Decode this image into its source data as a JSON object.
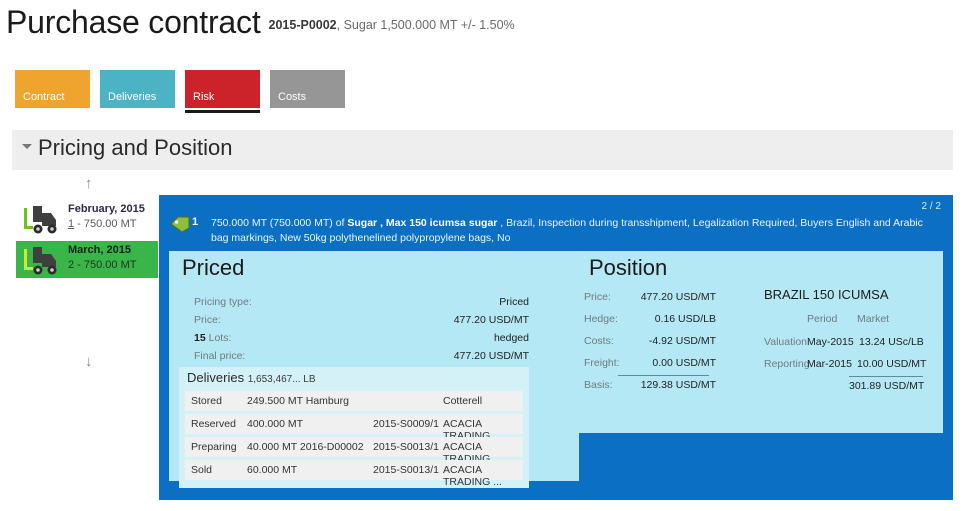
{
  "header": {
    "title": "Purchase contract",
    "ref": "2015-P0002",
    "subtitle": ", Sugar 1,500.000 MT +/- 1.50%"
  },
  "tabs": [
    {
      "label": "Contract",
      "color": "#F0A430",
      "selected": false
    },
    {
      "label": "Deliveries",
      "color": "#4BB3C4",
      "selected": false
    },
    {
      "label": "Risk",
      "color": "#CC2229",
      "selected": true
    },
    {
      "label": "Costs",
      "color": "#969696",
      "selected": false
    }
  ],
  "section": {
    "title": "Pricing and Position",
    "collapsed": false
  },
  "rail": {
    "scroll_up": "↑",
    "scroll_down": "↓",
    "items": [
      {
        "title": "February, 2015",
        "sub_num": "1",
        "sub_rest": " - 750.00 MT",
        "selected": false
      },
      {
        "title": "March, 2015",
        "sub_num": "2",
        "sub_rest": " - 750.00 MT",
        "selected": true
      }
    ]
  },
  "card": {
    "pager": "2 / 2",
    "item_number": "1",
    "desc_pre": "750.000 MT (750.000 MT) of ",
    "desc_bold1": "Sugar , Max 150 icumsa sugar",
    "desc_post": " , Brazil, Inspection during transshipment, Legalization Required, Buyers English and Arabic bag markings, New 50kg polythenelined polypropylene bags, No"
  },
  "priced": {
    "title": "Priced",
    "rows": [
      {
        "key": "Pricing type:",
        "value": "Priced"
      },
      {
        "key": "Price:",
        "value": "477.20 USD/MT"
      },
      {
        "key_bold": "15",
        "key": " Lots:",
        "value": "hedged"
      },
      {
        "key": "Final price:",
        "value": "477.20 USD/MT"
      }
    ],
    "deliveries": {
      "title": "Deliveries",
      "total": "1,653,467... LB",
      "rows": [
        {
          "status": "Stored",
          "qty": "249.500 MT Hamburg",
          "ref": "",
          "party": "Cotterell"
        },
        {
          "status": "Reserved",
          "qty": "400.000 MT",
          "ref": "2015-S0009/1",
          "party": "ACACIA TRADING ..."
        },
        {
          "status": "Preparing",
          "qty": "40.000 MT 2016-D00002",
          "ref": "2015-S0013/1",
          "party": "ACACIA TRADING ..."
        },
        {
          "status": "Sold",
          "qty": "60.000 MT",
          "ref": "2015-S0013/1",
          "party": "ACACIA TRADING ..."
        }
      ]
    }
  },
  "position": {
    "title": "Position",
    "rows": [
      {
        "key": "Price:",
        "value": "477.20 USD/MT"
      },
      {
        "key": "Hedge:",
        "value": "0.16 USD/LB"
      },
      {
        "key": "Costs:",
        "value": "-4.92 USD/MT"
      },
      {
        "key": "Freight:",
        "value": "0.00 USD/MT"
      },
      {
        "key": "Basis:",
        "value": "129.38 USD/MT"
      }
    ],
    "market": {
      "title": "BRAZIL 150 ICUMSA",
      "col_period": "Period",
      "col_market": "Market",
      "valuation_label": "Valuation",
      "valuation_period": "May-2015",
      "valuation_market": "13.24 USc/LB",
      "reporting_label": "Reporting",
      "reporting_period": "Mar-2015",
      "reporting_market": "10.00 USD/MT",
      "total": "301.89 USD/MT"
    }
  },
  "icons": {
    "truck": "forklift-truck-icon",
    "tag": "price-tag-icon",
    "caret": "chevron-down-icon"
  }
}
